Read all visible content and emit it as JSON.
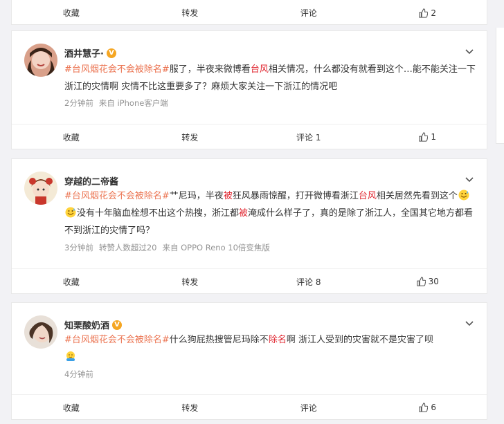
{
  "top_actions": {
    "collect": "收藏",
    "repost": "转发",
    "comment": "评论",
    "like": "2"
  },
  "posts": [
    {
      "username": "酒井慧子·",
      "verified": true,
      "topic": "#台风烟花会不会被除名#",
      "text_1": "服了，半夜来微博看",
      "kw_1": "台风",
      "text_2": "相关情况，什么都没有就看到这个…能不能关注一下浙江的灾情啊 灾情不比这重要多了？麻烦大家关注一下浙江的情况吧",
      "time": "2分钟前",
      "source": "来自 iPhone客户端",
      "collect": "收藏",
      "repost": "转发",
      "comment": "评论 1",
      "like": "1"
    },
    {
      "username": "穿越的二帝酱",
      "verified": false,
      "topic": "#台风烟花会不会被除名#",
      "text_1": "艹尼玛，半夜",
      "kw_1": "被",
      "text_2": "狂风暴雨惊醒，打开微博看浙江",
      "kw_2": "台风",
      "text_3": "相关居然先看到这个",
      "text_4": "没有十年脑血栓想不出这个热搜，浙江都",
      "kw_3": "被",
      "text_5": "淹成什么样子了，真的是除了浙江人，全国其它地方都看不到浙江的灾情了吗？",
      "time": "3分钟前",
      "repost_info": "转赞人数超过20",
      "source": "来自 OPPO Reno 10倍变焦版",
      "collect": "收藏",
      "repost": "转发",
      "comment": "评论 8",
      "like": "30"
    },
    {
      "username": "知栗酸奶酒",
      "verified": true,
      "topic": "#台风烟花会不会被除名#",
      "text_1": "什么狗屁热搜管尼玛除不",
      "kw_1": "除名",
      "text_2": "啊 浙江人受到的灾害就不是灾害了呗",
      "time": "4分钟前",
      "collect": "收藏",
      "repost": "转发",
      "comment": "评论",
      "like": "6"
    }
  ],
  "colors": {
    "topic": "#eb7350",
    "keyword": "#e0252f",
    "badge": "#f5a623",
    "meta": "#939393"
  },
  "icons": {
    "like": "thumbs-up-icon",
    "menu": "chevron-down-icon",
    "verified": "verified-badge-icon",
    "emoji_1": "sweat-smile-emoji",
    "emoji_2": "hug-emoji"
  }
}
